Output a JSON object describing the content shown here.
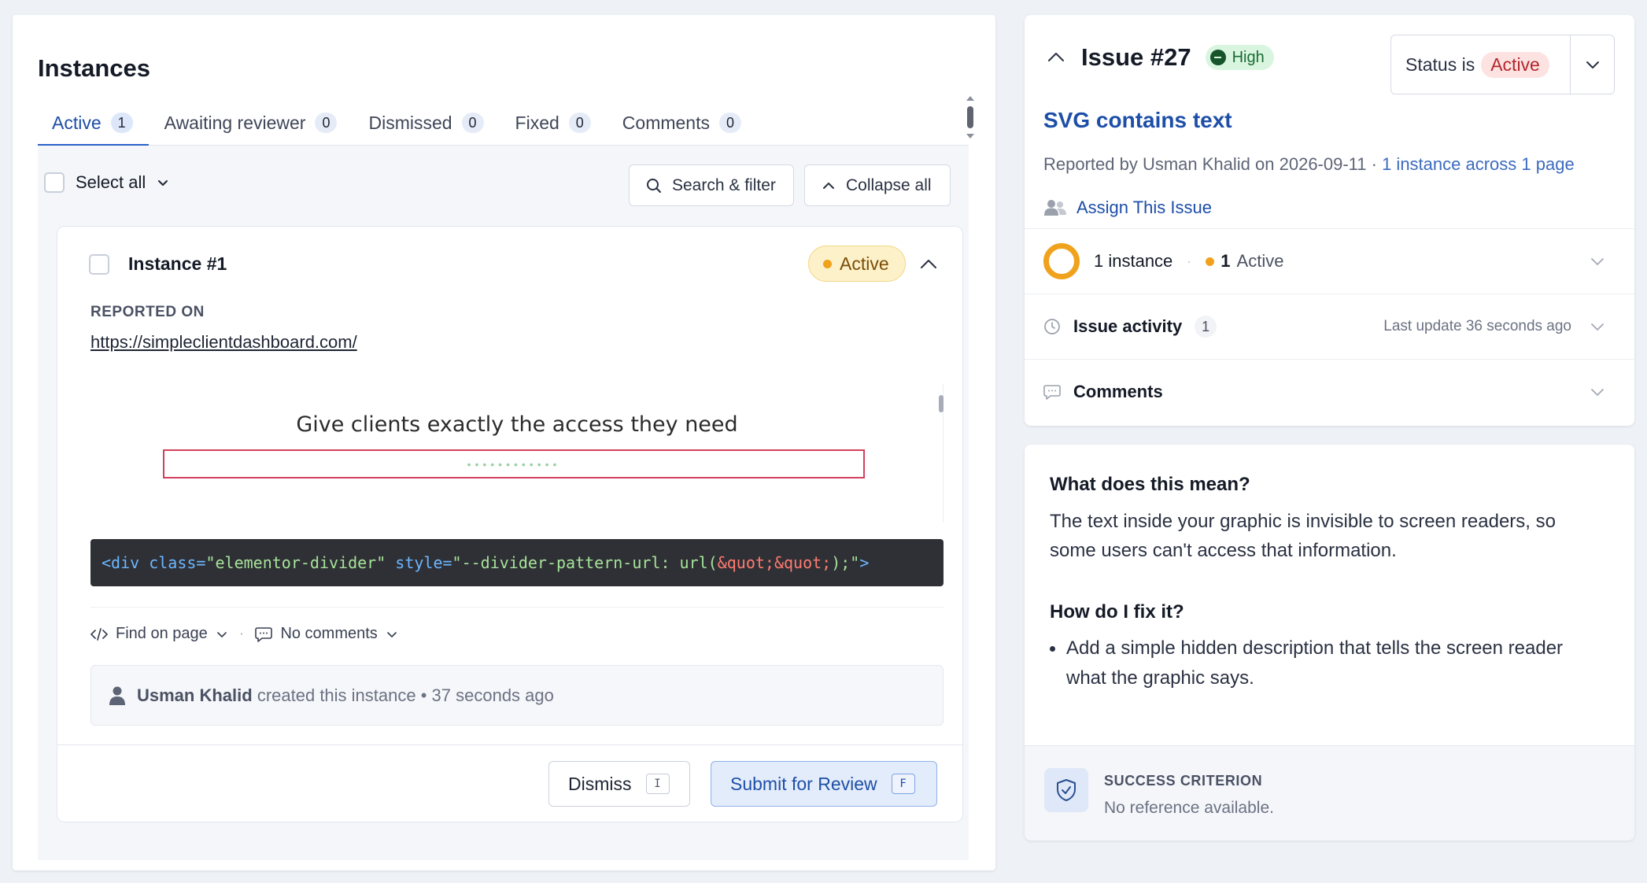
{
  "instances_panel": {
    "title": "Instances",
    "tabs": [
      {
        "label": "Active",
        "count": "1"
      },
      {
        "label": "Awaiting reviewer",
        "count": "0"
      },
      {
        "label": "Dismissed",
        "count": "0"
      },
      {
        "label": "Fixed",
        "count": "0"
      },
      {
        "label": "Comments",
        "count": "0"
      }
    ],
    "select_all_label": "Select all",
    "search_filter_label": "Search & filter",
    "collapse_all_label": "Collapse all"
  },
  "instance": {
    "title": "Instance #1",
    "status": "Active",
    "reported_on_label": "REPORTED ON",
    "url": "https://simpleclientdashboard.com/",
    "preview_heading": "Give clients exactly the access they need",
    "code": {
      "open": "<div",
      "attr1": " class=",
      "val1": "\"elementor-divider\"",
      "attr2": " style=",
      "val2_start": "\"--divider-pattern-url: url(",
      "val2_entity": "&quot;&quot;",
      "val2_end": ");\"",
      "close": ">"
    },
    "find_on_page_label": "Find on page",
    "no_comments_label": "No comments",
    "activity_user": "Usman Khalid",
    "activity_text": "created this instance • 37 seconds ago",
    "dismiss_label": "Dismiss",
    "dismiss_key": "I",
    "submit_label": "Submit for Review",
    "submit_key": "F"
  },
  "issue": {
    "title": "Issue #27",
    "severity": "High",
    "status_prefix": "Status is",
    "status_value": "Active",
    "name": "SVG contains text",
    "meta_prefix": "Reported by Usman Khalid on 2026-09-11 · ",
    "meta_highlight": "1 instance across 1 page",
    "assign_label": "Assign This Issue",
    "instances_summary": "1 instance",
    "active_count": "1",
    "active_label": "Active",
    "activity_label": "Issue activity",
    "activity_count": "1",
    "last_update": "Last update 36 seconds ago",
    "comments_label": "Comments"
  },
  "help": {
    "q1": "What does this mean?",
    "a1": "The text inside your graphic is invisible to screen readers, so some users can't access that information.",
    "q2": "How do I fix it?",
    "fix1": "Add a simple hidden description that tells the screen reader what the graphic says.",
    "criterion_label": "SUCCESS CRITERION",
    "criterion_value": "No reference available."
  },
  "colors": {
    "accent": "#2a62c9",
    "link": "#1d4ea8",
    "active_amber": "#f0a21c",
    "severity_green": "#17542c",
    "status_red": "#b4262c"
  }
}
